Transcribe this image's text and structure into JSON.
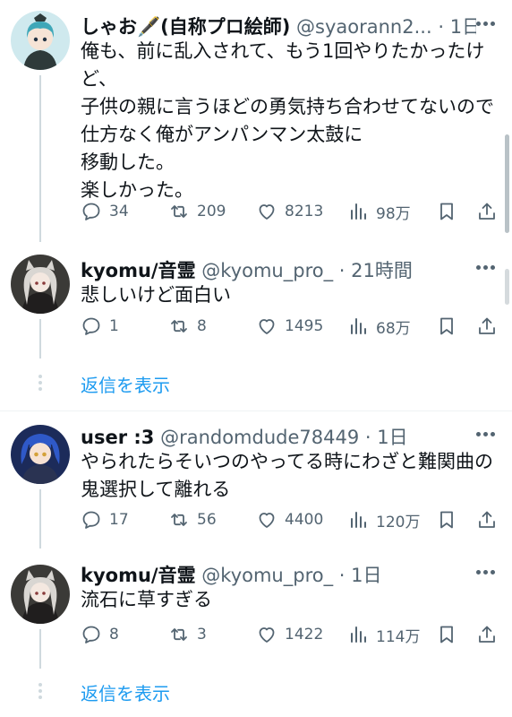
{
  "posts": [
    {
      "name": "しゃお🖋️(自称プロ絵師)",
      "handle": "@syaorann2...",
      "time": "1日",
      "lines": [
        "俺も、前に乱入されて、もう1回やりたかったけ",
        "ど、",
        "子供の親に言うほどの勇気持ち合わせてないので",
        "仕方なく俺がアンパンマン太鼓に",
        "移動した。",
        "楽しかった。"
      ],
      "replies": "34",
      "reposts": "209",
      "likes": "8213",
      "views": "98万"
    },
    {
      "name": "kyomu/音霊",
      "handle": "@kyomu_pro_",
      "time": "21時間",
      "lines": [
        "悲しいけど面白い"
      ],
      "replies": "1",
      "reposts": "8",
      "likes": "1495",
      "views": "68万"
    },
    {
      "name": "user :3",
      "handle": "@randomdude78449",
      "time": "1日",
      "lines": [
        "やられたらそいつのやってる時にわざと難関曲の",
        "鬼選択して離れる"
      ],
      "replies": "17",
      "reposts": "56",
      "likes": "4400",
      "views": "120万"
    },
    {
      "name": "kyomu/音霊",
      "handle": "@kyomu_pro_",
      "time": "1日",
      "lines": [
        "流石に草すぎる"
      ],
      "replies": "8",
      "reposts": "3",
      "likes": "1422",
      "views": "114万"
    }
  ],
  "show_replies_label": "返信を表示",
  "colors": {
    "accent": "#1d9bf0",
    "secondary_text": "#536471",
    "thread_line": "#cfd9de"
  },
  "icons": [
    "reply-icon",
    "repost-icon",
    "like-icon",
    "views-icon",
    "bookmark-icon",
    "share-icon",
    "more-icon"
  ]
}
